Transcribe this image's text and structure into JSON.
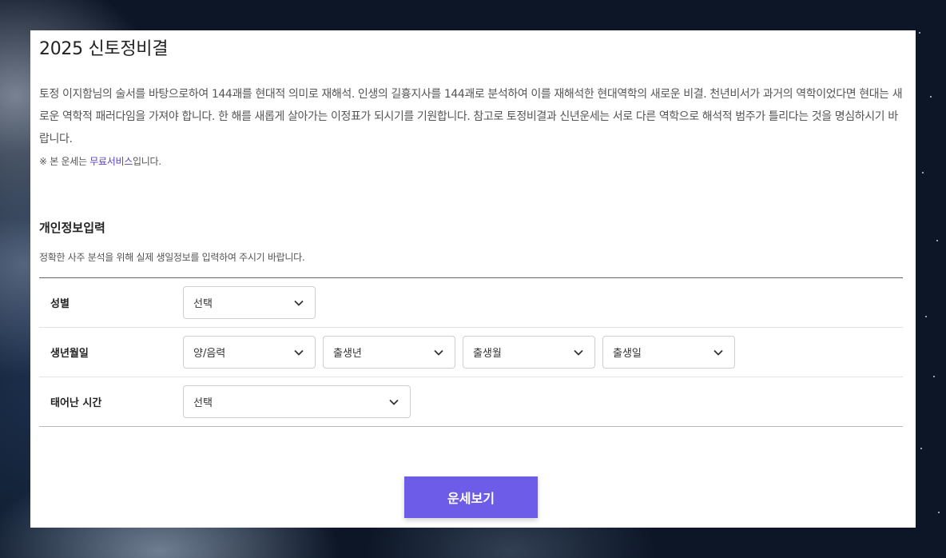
{
  "page": {
    "title": "2025 신토정비결",
    "description": "토정 이지함님의 술서를 바탕으로하여 144괘를 현대적 의미로 재해석. 인생의 길흉지사를 144괘로 분석하여 이를 재해석한 현대역학의 새로운 비결. 천년비서가 과거의 역학이었다면 현대는 새로운 역학적 패러다임을 가져야 합니다. 한 해를 새롭게 살아가는 이정표가 되시기를 기원합니다. 참고로 토정비결과 신년운세는 서로 다른 역학으로 해석적 범주가 틀리다는 것을 명심하시기 바랍니다.",
    "note_prefix": "※ 본 운세는 ",
    "note_link": "무료서비스",
    "note_suffix": "입니다."
  },
  "section": {
    "title": "개인정보입력",
    "subtitle": "정확한 사주 분석을 위해 실제 생일정보를 입력하여 주시기 바랍니다."
  },
  "form": {
    "gender": {
      "label": "성별",
      "value": "선택"
    },
    "birth": {
      "label": "생년월일",
      "calendar": "양/음력",
      "year": "출생년",
      "month": "출생월",
      "day": "출생일"
    },
    "time": {
      "label": "태어난 시간",
      "value": "선택"
    }
  },
  "submit_label": "운세보기",
  "colors": {
    "accent": "#6c5ce7",
    "link": "#5a3fbf"
  }
}
